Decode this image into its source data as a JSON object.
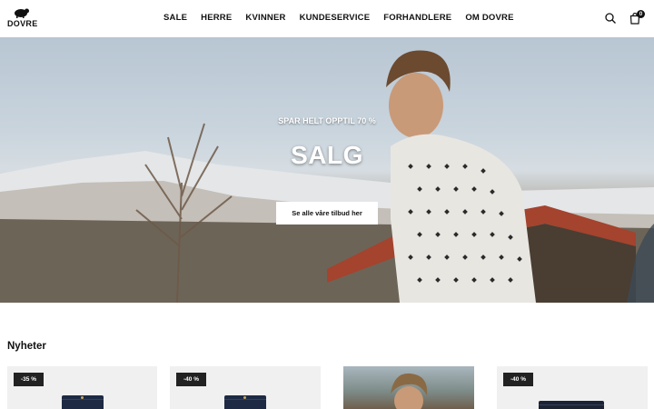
{
  "brand": {
    "name": "DOVRE"
  },
  "nav": {
    "items": [
      "SALE",
      "HERRE",
      "KVINNER",
      "KUNDESERVICE",
      "FORHANDLERE",
      "OM DOVRE"
    ]
  },
  "header": {
    "search_icon": "search-icon",
    "cart_icon": "shopping-bag-icon",
    "cart_count": "0"
  },
  "hero": {
    "eyebrow": "SPAR HELT OPPTIL 70 %",
    "title": "SALG",
    "cta": "Se alle våre tilbud her"
  },
  "new_arrivals": {
    "title": "Nyheter",
    "products": [
      {
        "badge": "-35 %"
      },
      {
        "badge": "-40 %"
      },
      {
        "badge": ""
      },
      {
        "badge": "-40 %"
      }
    ]
  },
  "colors": {
    "accent": "#111111",
    "badge_bg": "#222222",
    "card_bg": "#f0f0f0"
  }
}
